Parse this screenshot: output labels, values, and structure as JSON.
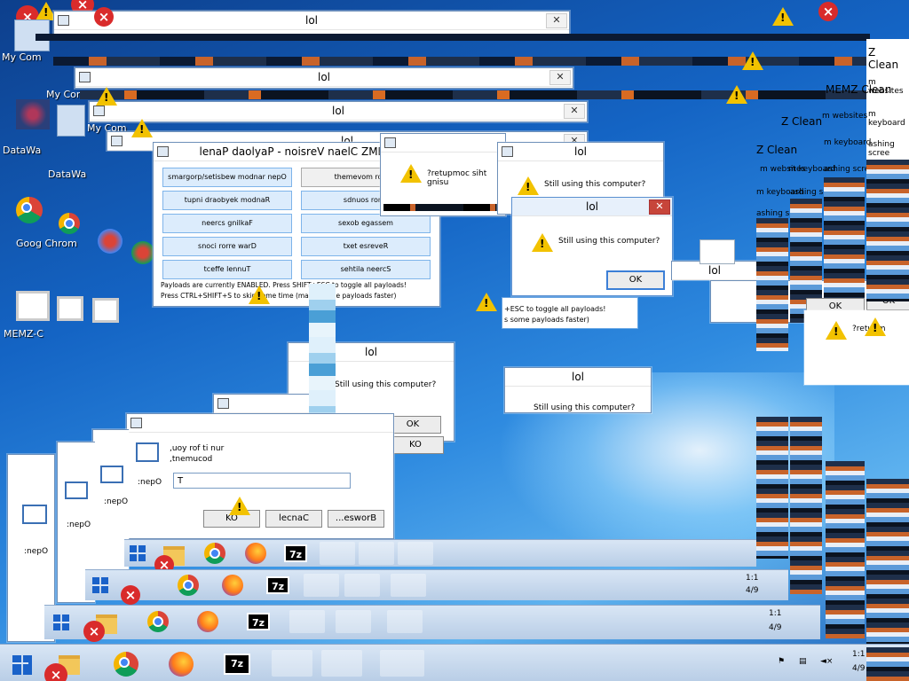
{
  "desktop_icons": {
    "my_computer": "My Com",
    "datawall": "DataWa",
    "chrome": "Goog Chrom",
    "memz": "MEMZ-C"
  },
  "memz_panel": {
    "title": "lenaP daolyaP - noisreV naelC ZMEM",
    "buttons": [
      "smargorp/setisbew modnar nepO",
      "themevom rosruc",
      "tupni draobyek modnaR",
      "sdnuos rorre",
      "neercs gnilkaF",
      "sexob egassem",
      "snoci rorre warD",
      "txet esreveR",
      "tceffe lennuT",
      "sehtila neercS"
    ],
    "hint_line1": "Payloads are currently ENABLED. Press SHIFT+ESC to toggle all payloads!",
    "hint_line2": "Press CTRL+SHIFT+S to skip some time (makes some payloads faster)"
  },
  "dialogs": {
    "lol": "lol",
    "question": "Still using this computer?",
    "question_mirrored": "?retupmoc siht gnisu",
    "question_mirrored_short": "?retupm",
    "ok": "OK",
    "ok_mirrored": "KO"
  },
  "hint_fragment": {
    "line1": "+ESC to toggle all payloads!",
    "line2": "s some payloads faster)"
  },
  "clean_titles": {
    "main": "MEMZ Clean",
    "short": "Z Clean"
  },
  "strip_texts": {
    "websites": "m websites",
    "keyboard": "m keyboard",
    "flashing": "ashing scree",
    "ok": "OK"
  },
  "mirrored_run": {
    "line1": ",uoy rof ti nur",
    "line2": ",tnemucod",
    "open_label": ":nepO",
    "value": "T",
    "ok": "KO",
    "cancel": "lecnaC",
    "browse": "...esworB"
  },
  "taskbar": {
    "time": "1:1",
    "date": "4/9"
  }
}
